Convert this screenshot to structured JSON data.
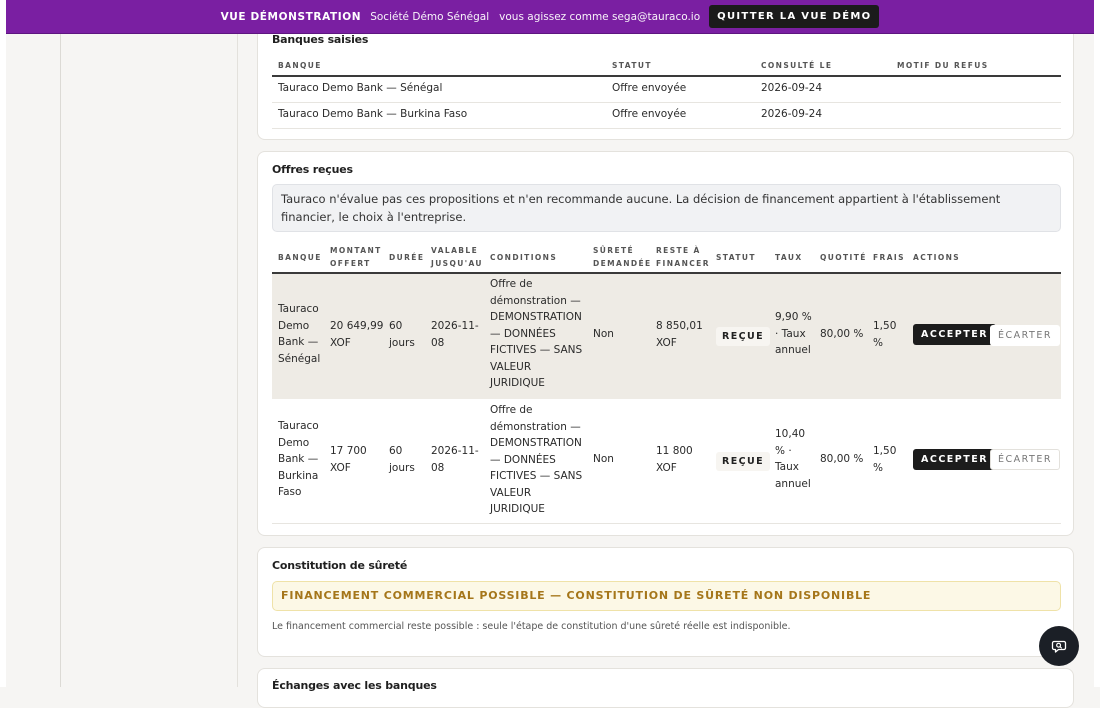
{
  "banner": {
    "mode_label": "VUE DÉMONSTRATION",
    "company": "Société Démo Sénégal",
    "acting_as": "vous agissez comme sega@tauraco.io",
    "quit_label": "QUITTER LA VUE DÉMO",
    "color": "#7a1fa2"
  },
  "banks_entered": {
    "title": "Banques saisies",
    "columns": [
      "Banque",
      "Statut",
      "Consulté le",
      "Motif du refus"
    ],
    "rows": [
      {
        "bank": "Tauraco Demo Bank — Sénégal",
        "status": "Offre envoyée",
        "consulted": "2026-09-24",
        "reason": ""
      },
      {
        "bank": "Tauraco Demo Bank — Burkina Faso",
        "status": "Offre envoyée",
        "consulted": "2026-09-24",
        "reason": ""
      }
    ]
  },
  "offers": {
    "title": "Offres reçues",
    "notice": "Tauraco n'évalue pas ces propositions et n'en recommande aucune. La décision de financement appartient à l'établissement financier, le choix à l'entreprise.",
    "columns": {
      "bank": "Banque",
      "amount": "Montant offert",
      "duration": "Durée",
      "valid_until": "Valable jusqu'au",
      "conditions": "Conditions",
      "collateral": "Sûreté demandée",
      "remaining": "Reste à financer",
      "status": "Statut",
      "rate": "Taux",
      "quota": "Quotité",
      "fees": "Frais",
      "actions": "Actions"
    },
    "rows": [
      {
        "bank": "Tauraco Demo Bank — Sénégal",
        "amount": "20 649,99 XOF",
        "duration": "60 jours",
        "valid_until": "2026-11-08",
        "conditions": "Offre de démonstration — DEMONSTRATION — DONNÉES FICTIVES — SANS VALEUR JURIDIQUE",
        "collateral": "Non",
        "remaining": "8 850,01 XOF",
        "status": "REÇUE",
        "rate": "9,90 % · Taux annuel",
        "quota": "80,00 %",
        "fees": "1,50 %",
        "accept_label": "ACCEPTER",
        "reject_label": "ÉCARTER"
      },
      {
        "bank": "Tauraco Demo Bank — Burkina Faso",
        "amount": "17 700 XOF",
        "duration": "60 jours",
        "valid_until": "2026-11-08",
        "conditions": "Offre de démonstration — DEMONSTRATION — DONNÉES FICTIVES — SANS VALEUR JURIDIQUE",
        "collateral": "Non",
        "remaining": "11 800 XOF",
        "status": "REÇUE",
        "rate": "10,40 % · Taux annuel",
        "quota": "80,00 %",
        "fees": "1,50 %",
        "accept_label": "ACCEPTER",
        "reject_label": "ÉCARTER"
      }
    ]
  },
  "collateral": {
    "title": "Constitution de sûreté",
    "warning": "FINANCEMENT COMMERCIAL POSSIBLE — CONSTITUTION DE SÛRETÉ NON DISPONIBLE",
    "note": "Le financement commercial reste possible : seule l'étape de constitution d'une sûreté réelle est indisponible."
  },
  "exchanges": {
    "title": "Échanges avec les banques"
  },
  "chat_button": {
    "icon": "chat-search-icon"
  }
}
